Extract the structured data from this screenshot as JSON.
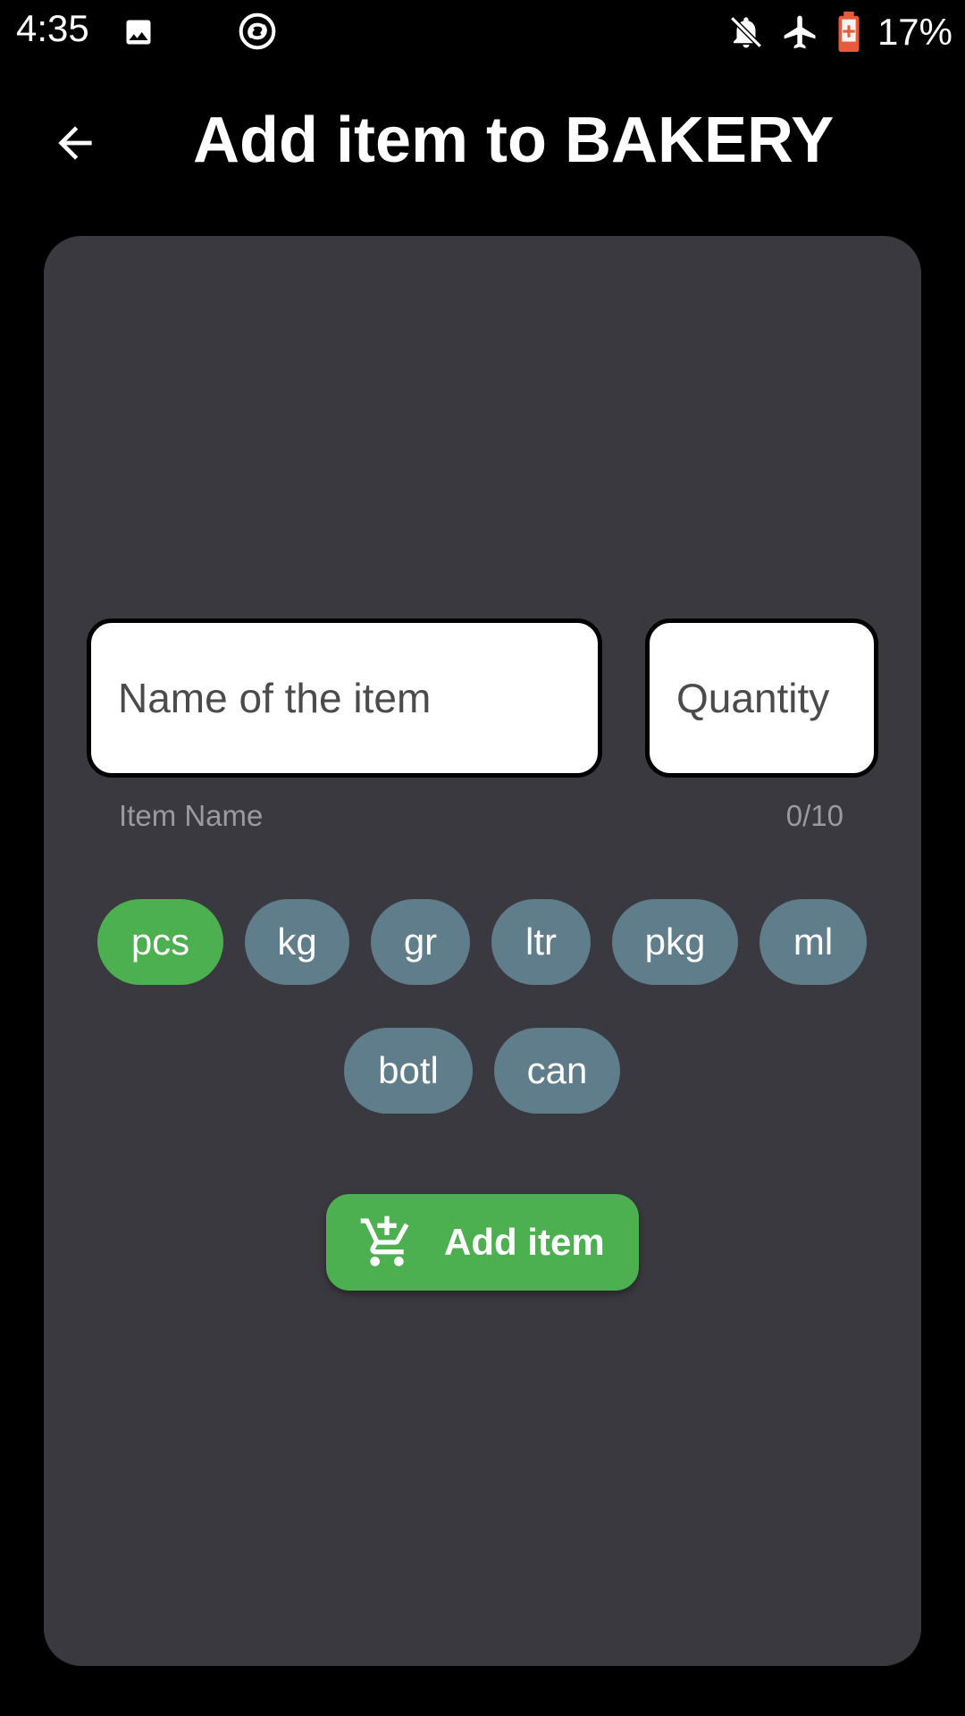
{
  "status_bar": {
    "time": "4:35",
    "battery_percent": "17%",
    "icons": [
      "image-icon",
      "app-swirl-icon",
      "bell-off-icon",
      "airplane-icon",
      "battery-charging-icon"
    ]
  },
  "header": {
    "title": "Add item to BAKERY",
    "back_icon": "arrow-left-icon"
  },
  "form": {
    "name_field": {
      "placeholder": "Name of the item",
      "value": ""
    },
    "quantity_field": {
      "placeholder": "Quantity",
      "value": ""
    },
    "helper_label": "Item Name",
    "char_counter": "0/10"
  },
  "units": [
    {
      "label": "pcs",
      "selected": true
    },
    {
      "label": "kg",
      "selected": false
    },
    {
      "label": "gr",
      "selected": false
    },
    {
      "label": "ltr",
      "selected": false
    },
    {
      "label": "pkg",
      "selected": false
    },
    {
      "label": "ml",
      "selected": false
    },
    {
      "label": "botl",
      "selected": false
    },
    {
      "label": "can",
      "selected": false
    }
  ],
  "add_button": {
    "label": "Add item",
    "icon": "add-shopping-cart-icon"
  },
  "colors": {
    "background": "#000000",
    "card": "#3a393f",
    "chip_default": "#607d8b",
    "chip_selected": "#4caf50",
    "accent": "#4caf50"
  }
}
